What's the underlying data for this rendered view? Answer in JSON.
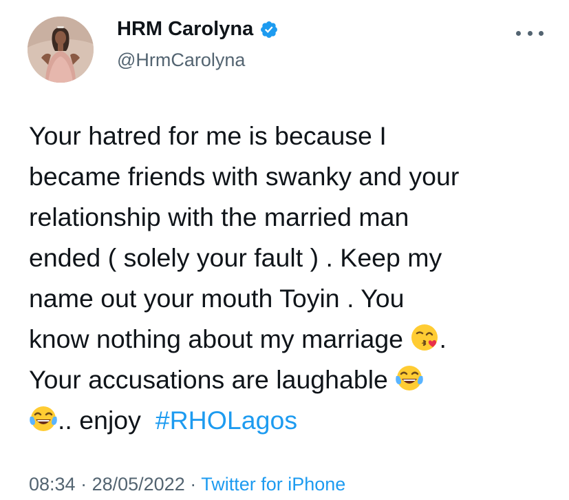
{
  "author": {
    "display_name": "HRM Carolyna",
    "handle": "@HrmCarolyna",
    "verified_icon": "verified-badge-icon",
    "accent_color": "#1d9bf0"
  },
  "tweet": {
    "line1": "Your hatred for me is because I",
    "line2": "became friends with swanky and your",
    "line3": "relationship with the married man",
    "line4": "ended ( solely your fault ) . Keep my",
    "line5": "name out your mouth Toyin . You",
    "line6_text": "know nothing about my marriage ",
    "line6_after": ".",
    "line7_text": "Your accusations are laughable ",
    "line8_text": ".. enjoy  ",
    "hashtag": "#RHOLagos",
    "emojis": [
      "face-blowing-kiss-emoji",
      "tears-of-joy-emoji",
      "tears-of-joy-emoji"
    ]
  },
  "meta": {
    "time": "08:34",
    "separator": " · ",
    "date": "28/05/2022",
    "source": "Twitter for iPhone"
  },
  "icons": {
    "more": "more-options-icon"
  }
}
